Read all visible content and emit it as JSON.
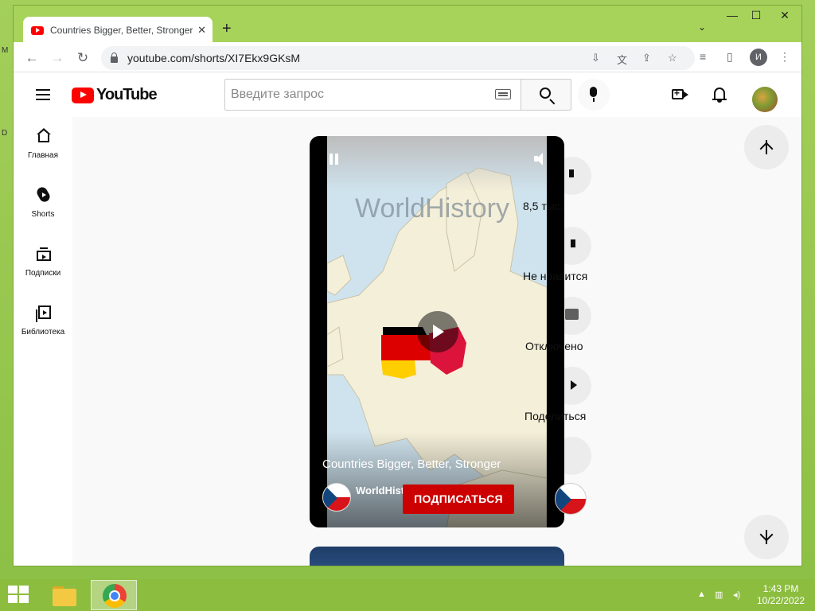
{
  "browser": {
    "tab_title": "Countries Bigger, Better, Stronger",
    "tab_close": "✕",
    "new_tab": "+",
    "tab_search": "⌄",
    "window_controls": {
      "minimize": "—",
      "maximize": "☐",
      "close": "✕"
    },
    "url": "youtube.com/shorts/XI7Ekx9GKsM",
    "profile_initial": "И"
  },
  "youtube": {
    "logo_text": "YouTube",
    "search_placeholder": "Введите запрос",
    "sidebar": [
      {
        "id": "home",
        "label": "Главная"
      },
      {
        "id": "shorts",
        "label": "Shorts"
      },
      {
        "id": "subscriptions",
        "label": "Подписки"
      },
      {
        "id": "library",
        "label": "Библиотека"
      }
    ]
  },
  "short": {
    "title": "Countries Bigger, Better, Stronger",
    "watermark": "WorldHistory",
    "channel_name": "WorldHistory",
    "subscribe_label": "ПОДПИСАТЬСЯ",
    "actions": {
      "likes": "8,5 тыс.",
      "dislike": "Не нравится",
      "comments": "Отключено",
      "share": "Поделиться"
    }
  },
  "taskbar": {
    "time": "1:43 PM",
    "date": "10/22/2022",
    "tray_icons": [
      "▲",
      "network-icon",
      "volume-icon"
    ]
  },
  "colors": {
    "desktop": "#8fc24a",
    "youtube_red": "#ff0000",
    "subscribe_red": "#cc0000",
    "germany_black": "#000000",
    "germany_red": "#dd0000",
    "germany_gold": "#ffce00",
    "poland_red": "#dc143c"
  }
}
